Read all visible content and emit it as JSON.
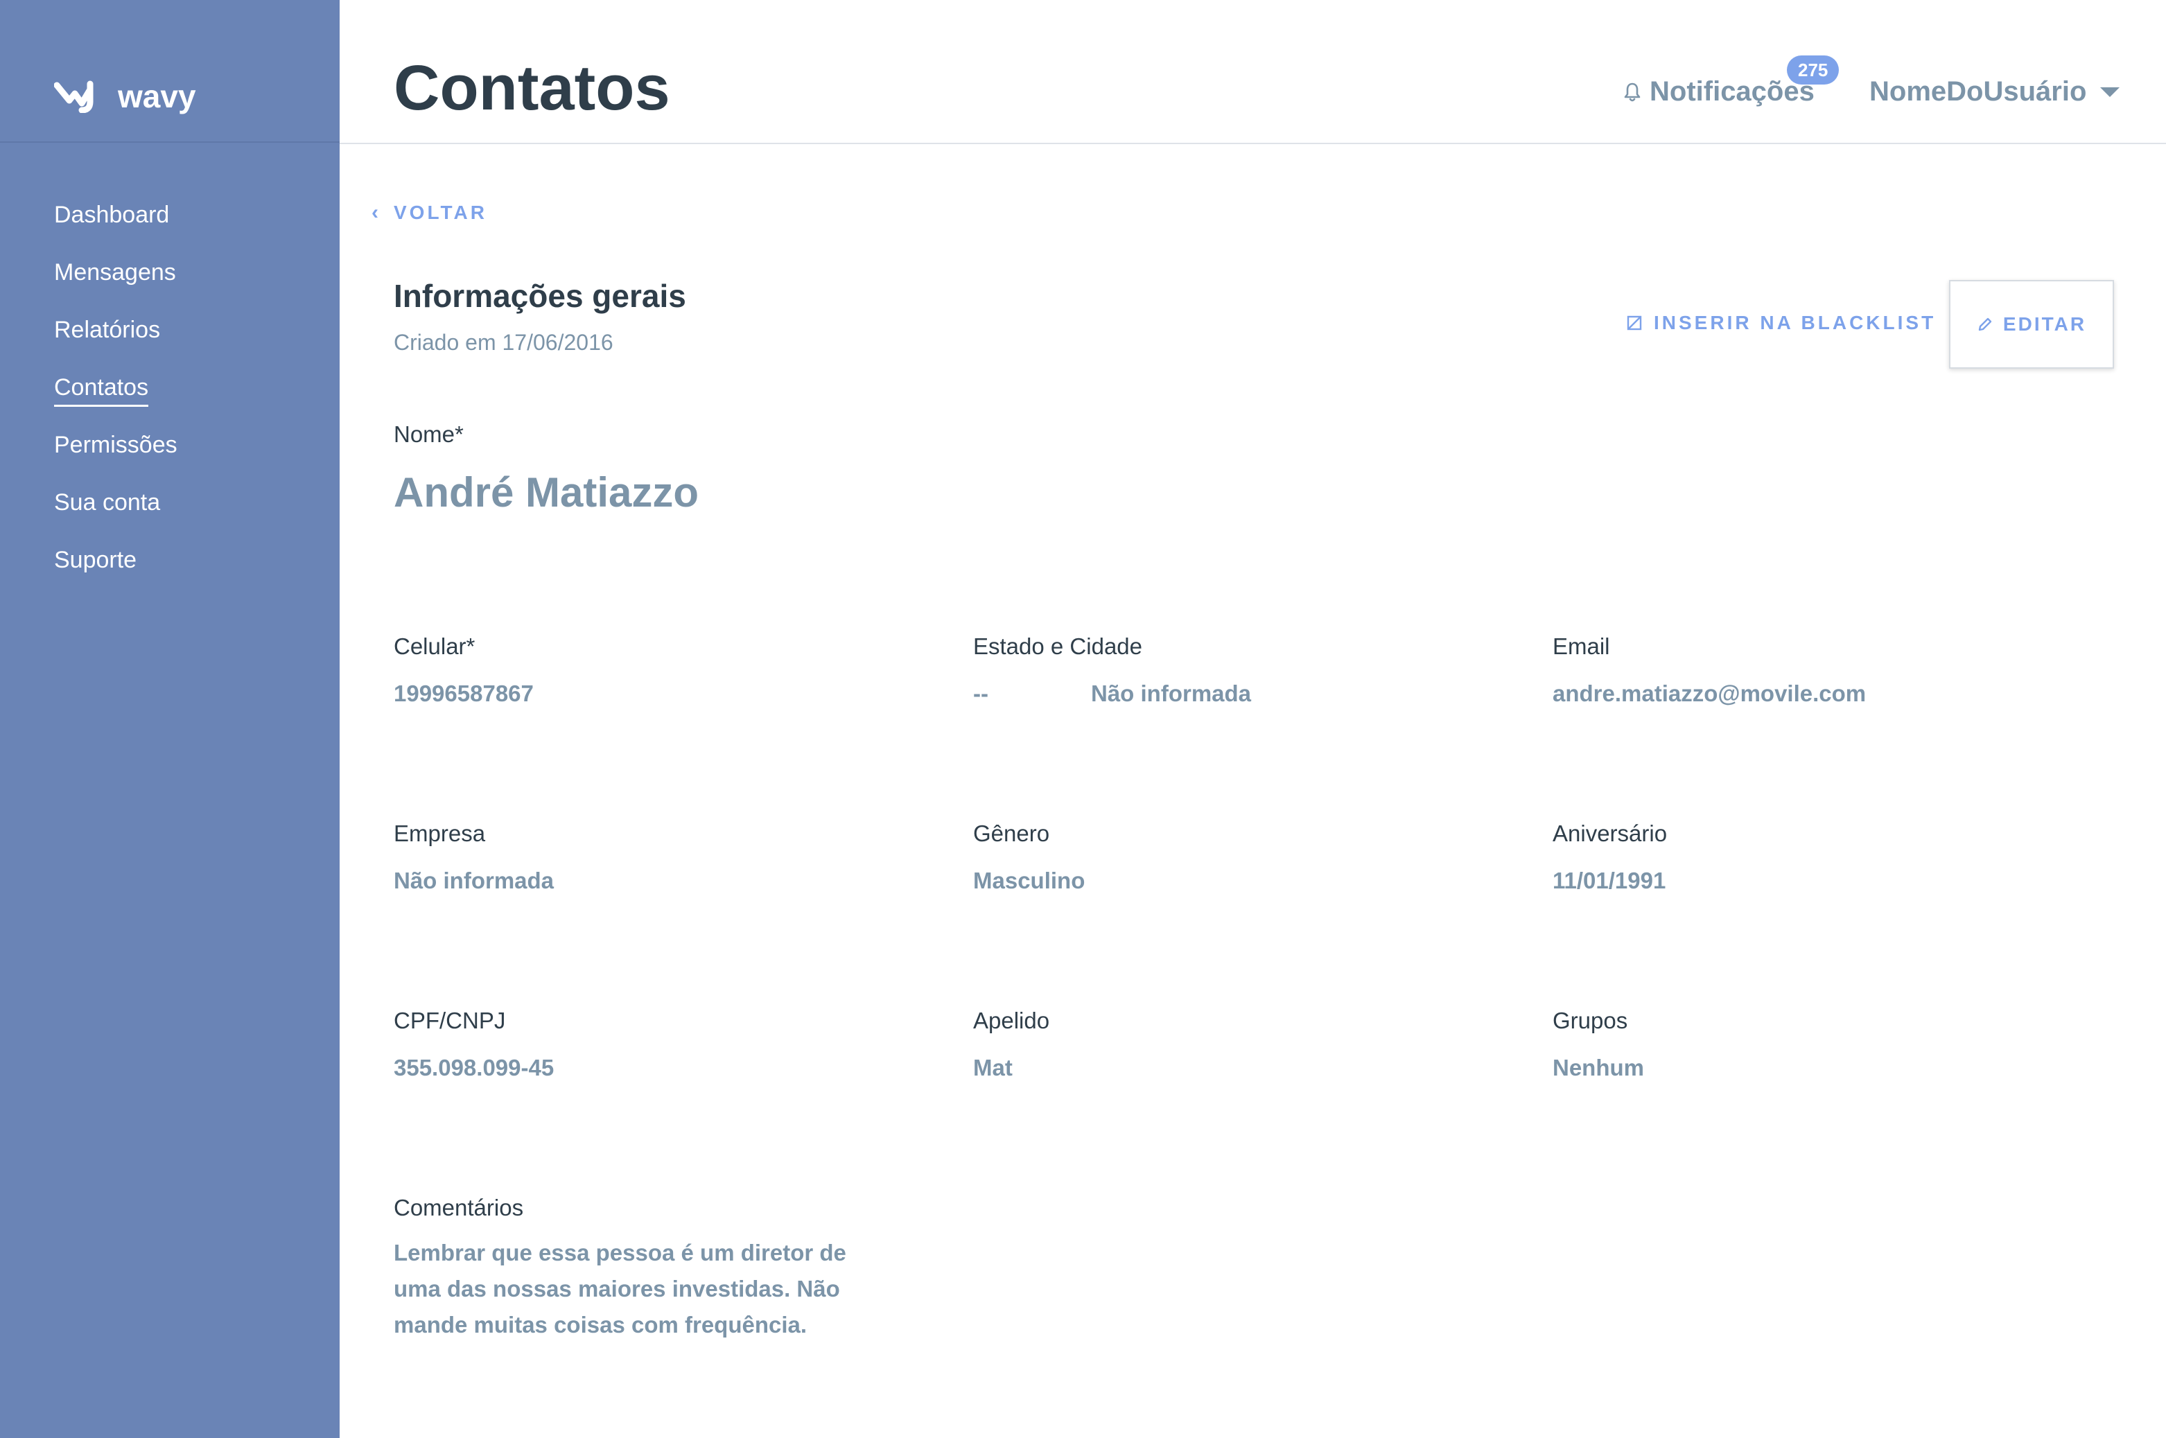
{
  "brand": {
    "name": "wavy",
    "logo_icon": "wavy-logo-icon"
  },
  "sidebar": {
    "items": [
      {
        "label": "Dashboard",
        "active": false
      },
      {
        "label": "Mensagens",
        "active": false
      },
      {
        "label": "Relatórios",
        "active": false
      },
      {
        "label": "Contatos",
        "active": true
      },
      {
        "label": "Permissões",
        "active": false
      },
      {
        "label": "Sua conta",
        "active": false
      },
      {
        "label": "Suporte",
        "active": false
      }
    ]
  },
  "header": {
    "title": "Contatos",
    "notifications_label": "Notificações",
    "notifications_count": "275",
    "notifications_icon": "bell-icon",
    "user_name": "NomeDoUsuário"
  },
  "content": {
    "back_label": "VOLTAR",
    "section_title": "Informações gerais",
    "created_text": "Criado em 17/06/2016",
    "blacklist_label": "INSERIR NA BLACKLIST",
    "edit_label": "EDITAR",
    "name_label": "Nome*",
    "name_value": "André Matiazzo",
    "fields": {
      "celular": {
        "label": "Celular*",
        "value": "19996587867"
      },
      "estado_cidade": {
        "label": "Estado e Cidade",
        "estado": "--",
        "cidade": "Não informada"
      },
      "email": {
        "label": "Email",
        "value": "andre.matiazzo@movile.com"
      },
      "empresa": {
        "label": "Empresa",
        "value": "Não informada"
      },
      "genero": {
        "label": "Gênero",
        "value": "Masculino"
      },
      "aniversario": {
        "label": "Aniversário",
        "value": "11/01/1991"
      },
      "cpf": {
        "label": "CPF/CNPJ",
        "value": "355.098.099-45"
      },
      "apelido": {
        "label": "Apelido",
        "value": "Mat"
      },
      "grupos": {
        "label": "Grupos",
        "value": "Nenhum"
      }
    },
    "comments": {
      "label": "Comentários",
      "value": "Lembrar que essa pessoa é um diretor de uma das nossas maiores investidas. Não mande muitas coisas com frequência."
    }
  },
  "colors": {
    "sidebar_bg": "#6a84b6",
    "accent": "#7da2ea",
    "title_text": "#2f3e4a",
    "value_text": "#7c94a8"
  }
}
